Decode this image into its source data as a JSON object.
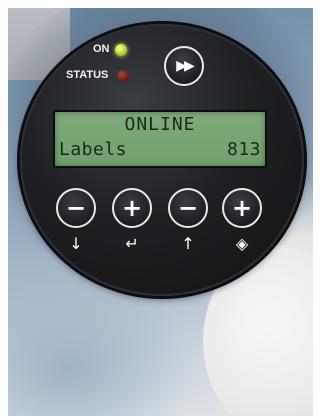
{
  "indicators": {
    "on_label": "ON",
    "status_label": "STATUS",
    "on_color": "#c6e13a",
    "status_color": "#6b1e19"
  },
  "display": {
    "line1": "ONLINE",
    "line2_label": "Labels",
    "line2_value": "813"
  },
  "buttons": [
    {
      "name": "minus-down-button",
      "glyph": "−",
      "icon": "arrow-down-icon",
      "icon_glyph": "↓"
    },
    {
      "name": "plus-enter-button",
      "glyph": "+",
      "icon": "enter-arrow-icon",
      "icon_glyph": "↵"
    },
    {
      "name": "minus-up-button",
      "glyph": "−",
      "icon": "arrow-up-icon",
      "icon_glyph": "↑"
    },
    {
      "name": "plus-feed-button",
      "glyph": "+",
      "icon": "feed-diamond-icon",
      "icon_glyph": "◈"
    }
  ],
  "fast_forward": {
    "glyph": "▶▶"
  }
}
